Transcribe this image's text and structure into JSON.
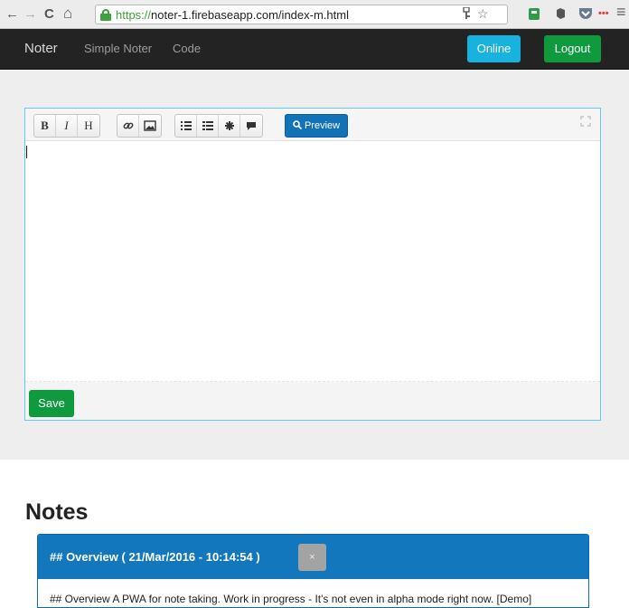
{
  "browser": {
    "url_scheme": "https://",
    "url_rest": "noter-1.firebaseapp.com/index-m.html",
    "back_glyph": "←",
    "forward_glyph": "→",
    "reload_glyph": "C",
    "home_glyph": "⌂",
    "menu_glyph": "≡"
  },
  "navbar": {
    "brand": "Noter",
    "links": [
      "Simple Noter",
      "Code"
    ],
    "online_label": "Online",
    "logout_label": "Logout"
  },
  "editor": {
    "toolbar": {
      "bold": "B",
      "italic": "I",
      "heading": "H",
      "preview_label": "Preview"
    },
    "save_label": "Save"
  },
  "notes": {
    "title": "Notes",
    "items": [
      {
        "title": "## Overview ( 21/Mar/2016 - 10:14:54 )",
        "close_label": "×",
        "body": "## Overview A PWA for note taking. Work in progress - It's not even in alpha mode right now. [Demo]"
      }
    ]
  },
  "colors": {
    "navbar_bg": "#232323",
    "online_btn": "#17b3de",
    "success_btn": "#0f9a3e",
    "primary": "#1377bd"
  }
}
